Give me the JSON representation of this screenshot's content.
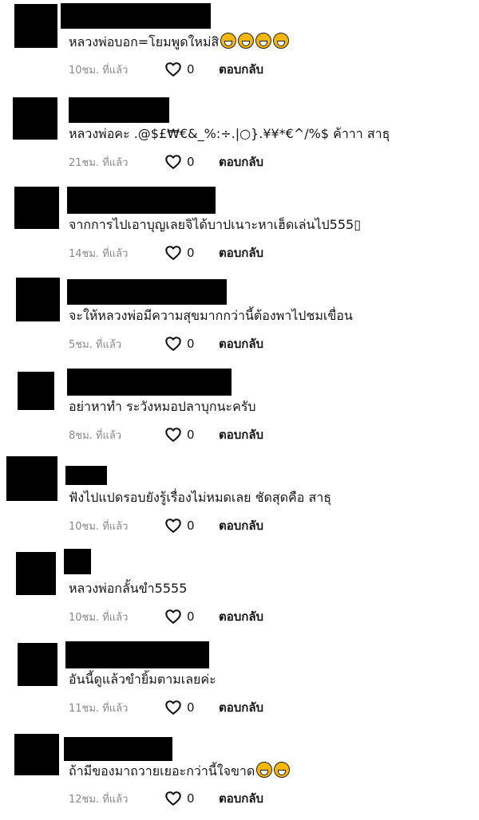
{
  "comments": [
    {
      "text": "หลวงพ่อบอก=โยมพูดใหม่สิ",
      "emojis": [
        "grinning-squint-face",
        "grinning-squint-face",
        "grinning-squint-face",
        "grinning-squint-face"
      ],
      "time": "10ชม. ที่แล้ว",
      "likes": "0",
      "reply": "ตอบกลับ"
    },
    {
      "text": "หลวงพ่อคะ .@$£₩€&_%:÷.|○}.¥¥*€^/%$ ค้าาา สาธุ",
      "emojis": [],
      "time": "21ชม. ที่แล้ว",
      "likes": "0",
      "reply": "ตอบกลับ"
    },
    {
      "text": "จากการไปเอาบุญเลยจิได้บาปเนาะหาเฮ็ดเล่นไป555▯",
      "emojis": [],
      "time": "14ชม. ที่แล้ว",
      "likes": "0",
      "reply": "ตอบกลับ"
    },
    {
      "text": "จะให้หลวงพ่อมีความสุขมากกว่านี้ต้องพาไปชมเขื่อน",
      "emojis": [],
      "time": "5ชม. ที่แล้ว",
      "likes": "0",
      "reply": "ตอบกลับ"
    },
    {
      "text": "อย่าหาทำ ระวังหมอปลาบุกนะครับ",
      "emojis": [],
      "time": "8ชม. ที่แล้ว",
      "likes": "0",
      "reply": "ตอบกลับ"
    },
    {
      "text": "ฟังไปแปดรอบยังรู้เรื่องไม่หมดเลย ชัดสุดคือ สาธุ",
      "emojis": [],
      "time": "10ชม. ที่แล้ว",
      "likes": "0",
      "reply": "ตอบกลับ"
    },
    {
      "text": "หลวงพ่อกลั้นขำ5555",
      "emojis": [],
      "time": "10ชม. ที่แล้ว",
      "likes": "0",
      "reply": "ตอบกลับ"
    },
    {
      "text": "อันนี้ดูแล้วขำยิ้มตามเลยค่ะ",
      "emojis": [],
      "time": "11ชม. ที่แล้ว",
      "likes": "0",
      "reply": "ตอบกลับ"
    },
    {
      "text": "ถ้ามีของมาถวายเยอะกว่านี้ใจขาด",
      "emojis": [
        "rolling-laughing-face",
        "rolling-laughing-face"
      ],
      "time": "12ชม. ที่แล้ว",
      "likes": "0",
      "reply": "ตอบกลับ"
    }
  ],
  "icons": {
    "like": "heart-outline-icon"
  },
  "colors": {
    "redaction": "#000000",
    "meta_text": "#8a8a8a",
    "emoji_fill": "#f5b800"
  }
}
